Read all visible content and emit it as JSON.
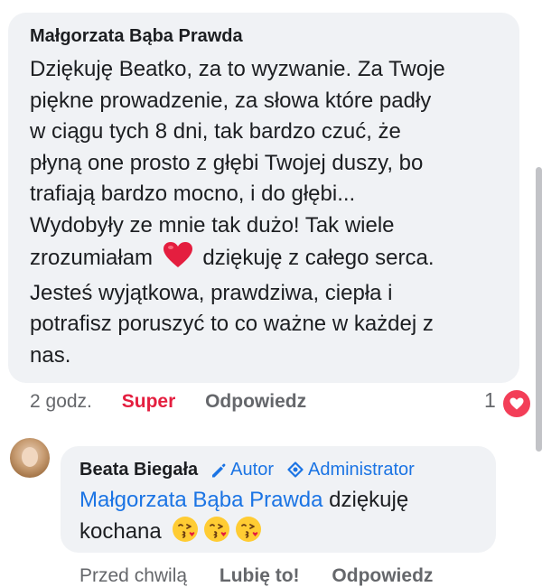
{
  "comment": {
    "author": "Małgorzata Bąba Prawda",
    "lines": [
      "Dziękuję Beatko, za to wyzwanie. Za Twoje",
      "piękne prowadzenie, za słowa które padły",
      "w ciągu tych 8 dni, tak bardzo czuć, że",
      "płyną one prosto z głębi Twojej duszy, bo",
      "trafiają bardzo mocno, i do głębi...",
      "Wydobyły ze mnie tak dużo! Tak wiele"
    ],
    "line7_before": "zrozumiałam",
    "line7_after": "dziękuję z całego serca.",
    "lines_after": [
      "Jesteś wyjątkowa, prawdziwa, ciepła i",
      "potrafisz poruszyć to co ważne w każdej z",
      "nas."
    ],
    "time": "2 godz.",
    "reaction_label": "Super",
    "reply_label": "Odpowiedz",
    "reaction_count": "1",
    "heart_color": "#e41e3f"
  },
  "reply": {
    "author": "Beata Biegała",
    "badge_author": "Autor",
    "badge_admin": "Administrator",
    "mention": "Małgorzata Bąba Prawda",
    "text_after_mention": "dziękuję",
    "text_line2": "kochana",
    "emoji_icons": [
      "face-blowing-kiss-icon",
      "face-blowing-kiss-icon",
      "face-blowing-kiss-icon"
    ],
    "time": "Przed chwilą",
    "like_label": "Lubię to!",
    "reply_label": "Odpowiedz"
  },
  "colors": {
    "link_blue": "#1b74e4",
    "bubble_bg": "#f0f2f5",
    "muted": "#65676b"
  }
}
